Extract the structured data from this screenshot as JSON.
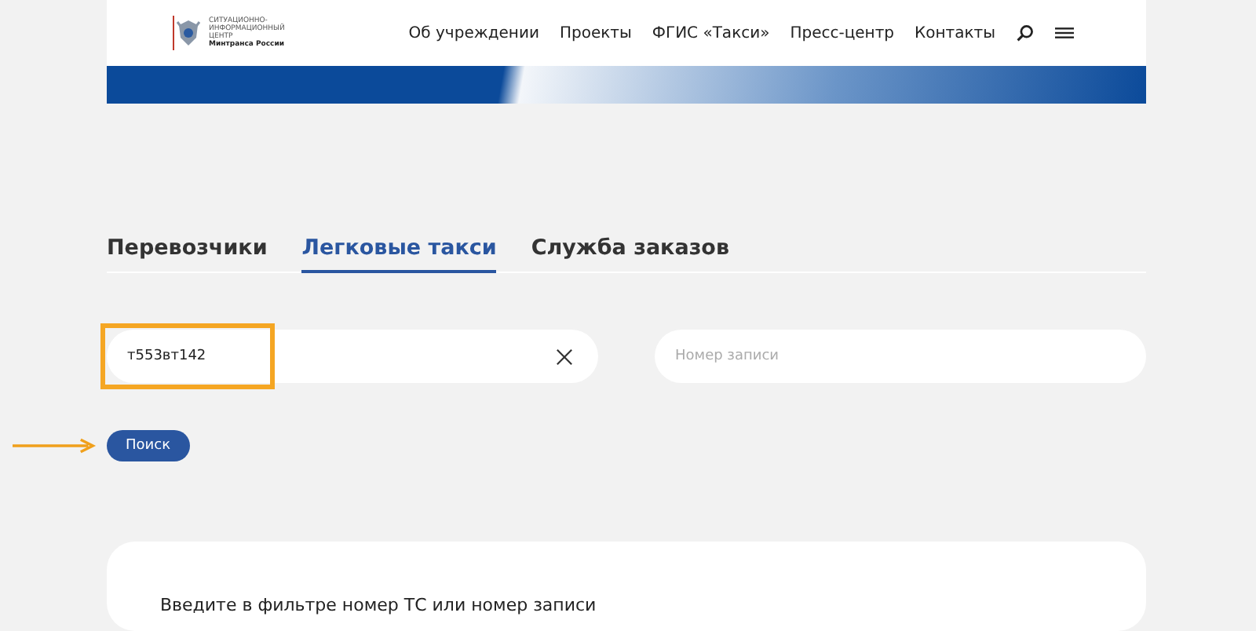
{
  "header": {
    "logo_lines": [
      "СИТУАЦИОННО-",
      "ИНФОРМАЦИОННЫЙ",
      "ЦЕНТР",
      "Минтранса России"
    ],
    "nav": [
      {
        "label": "Об учреждении"
      },
      {
        "label": "Проекты"
      },
      {
        "label": "ФГИС «Такси»"
      },
      {
        "label": "Пресс-центр"
      },
      {
        "label": "Контакты"
      }
    ]
  },
  "tabs": [
    {
      "label": "Перевозчики",
      "selected": false
    },
    {
      "label": "Легковые такси",
      "selected": true
    },
    {
      "label": "Служба заказов",
      "selected": false
    }
  ],
  "filters": [
    {
      "value": "т553вт142",
      "highlighted": true
    },
    {
      "placeholder": "Номер записи",
      "highlighted": false
    }
  ],
  "search_button": {
    "label": "Поиск"
  },
  "result_card": {
    "message": "Введите в фильтре номер ТС или номер записи"
  }
}
